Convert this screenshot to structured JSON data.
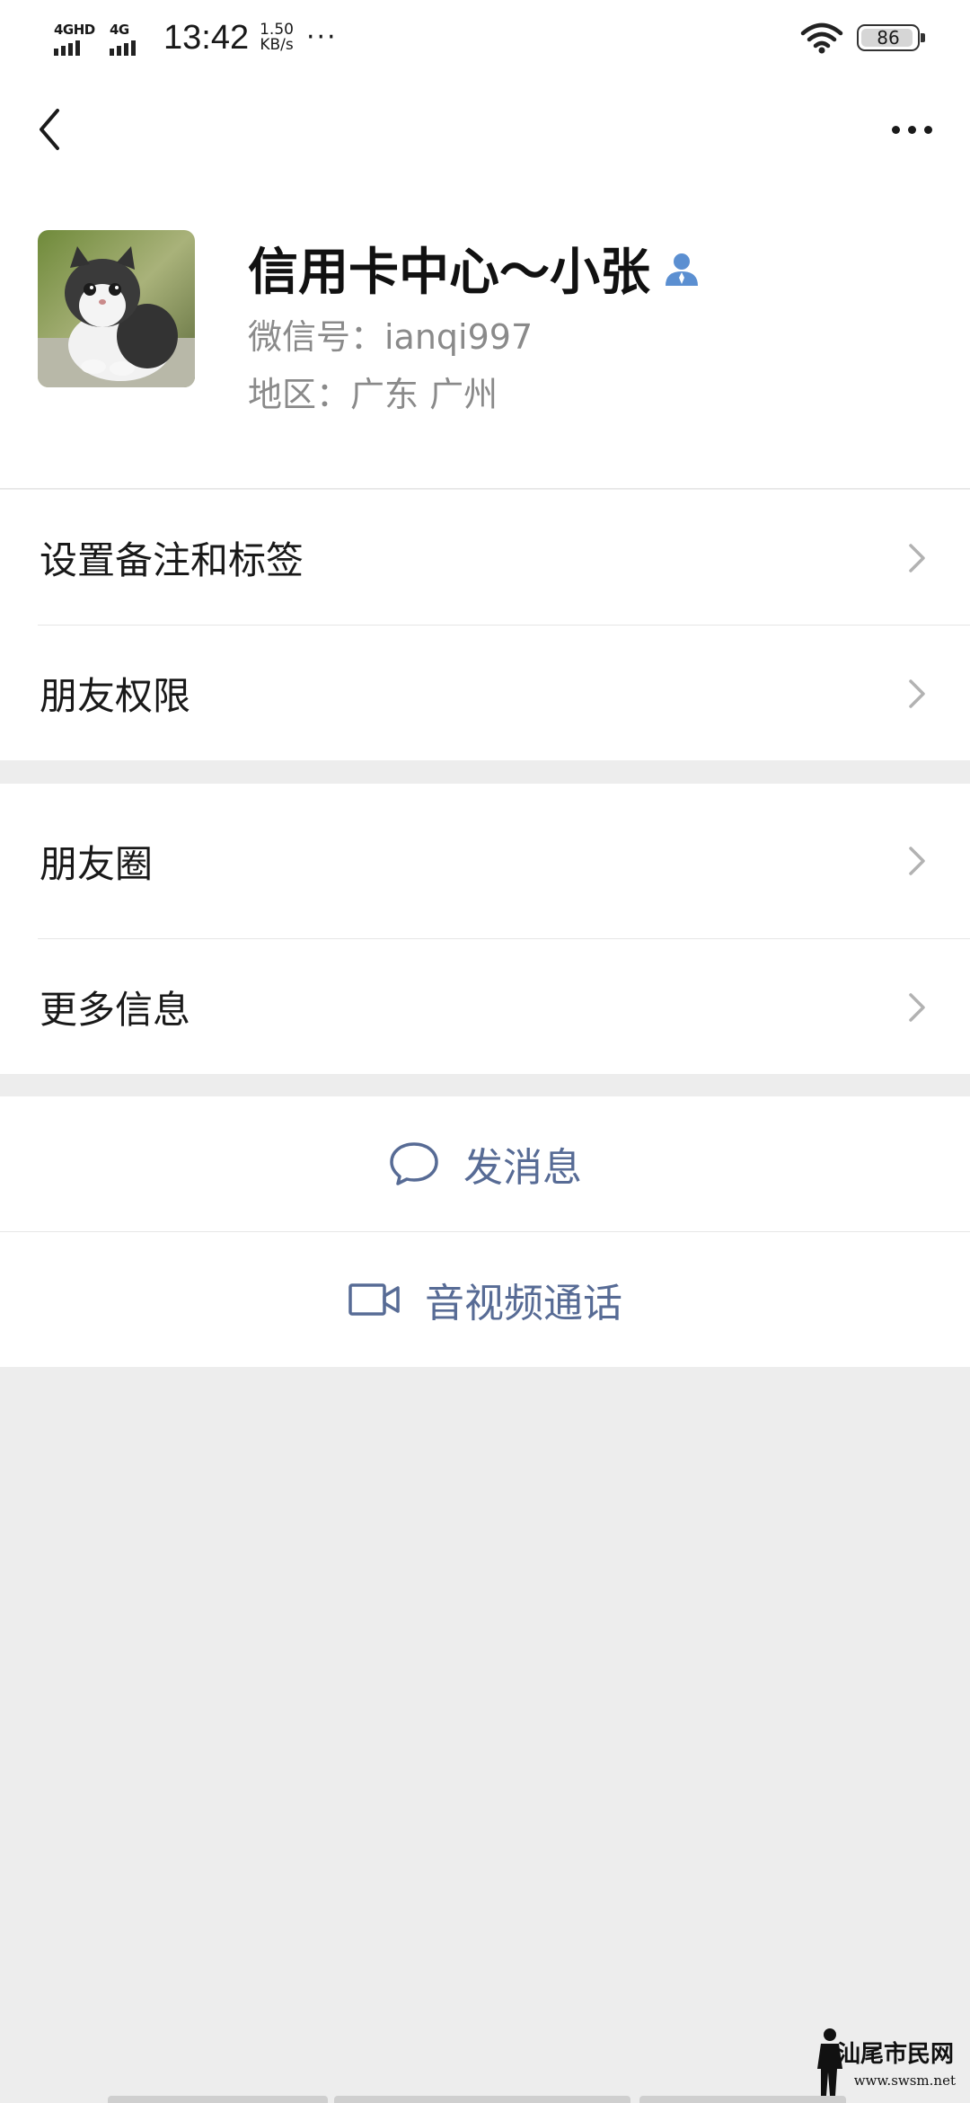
{
  "status_bar": {
    "network1": "4GHD",
    "network2": "4G",
    "time": "13:42",
    "speed_value": "1.50",
    "speed_unit": "KB/s",
    "more": "···",
    "battery": "86",
    "battery_level": 0.86
  },
  "nav": {
    "back_icon": "chevron-left-icon",
    "more_icon": "more-dots-icon"
  },
  "profile": {
    "nickname": "信用卡中心～小张",
    "wechat_id": "微信号：ianqi997",
    "region": "地区：广东  广州",
    "badge_icon": "person-icon",
    "badge_color": "#5b8fd1"
  },
  "menu_group_1": [
    {
      "label": "设置备注和标签"
    },
    {
      "label": "朋友权限"
    }
  ],
  "menu_group_2": [
    {
      "label": "朋友圈"
    },
    {
      "label": "更多信息"
    }
  ],
  "actions": {
    "send_message": "发消息",
    "video_call": "音视频通话",
    "link_color": "#576b95"
  },
  "watermark": {
    "text": "汕尾市民网",
    "url": "www.swsm.net"
  }
}
